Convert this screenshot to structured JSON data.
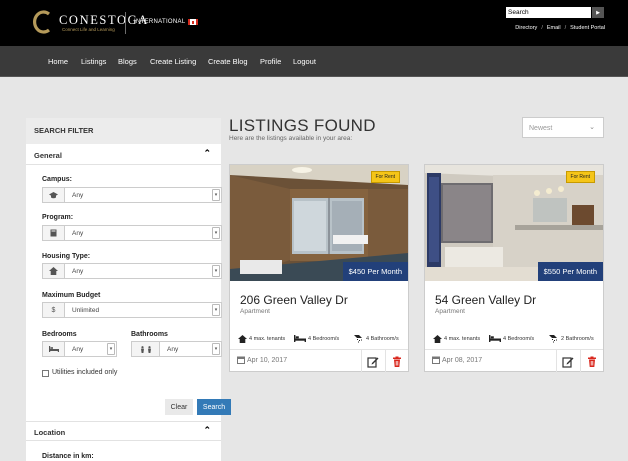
{
  "header": {
    "brand_name": "CONESTOGA",
    "brand_tagline": "Connect Life and Learning",
    "international_label": "INTERNATIONAL",
    "search_value": "Search",
    "utility_links": [
      "Directory",
      "Email",
      "Student Portal"
    ]
  },
  "nav": {
    "items": [
      "Home",
      "Listings",
      "Blogs",
      "Create Listing",
      "Create Blog",
      "Profile",
      "Logout"
    ]
  },
  "sidebar": {
    "title": "SEARCH FILTER",
    "general_section": "General",
    "campus_label": "Campus:",
    "campus_value": "Any",
    "program_label": "Program:",
    "program_value": "Any",
    "housing_label": "Housing Type:",
    "housing_value": "Any",
    "budget_label": "Maximum Budget",
    "budget_addon": "$",
    "budget_value": "Unlimited",
    "bedrooms_label": "Bedrooms",
    "bedrooms_value": "Any",
    "bathrooms_label": "Bathrooms",
    "bathrooms_value": "Any",
    "utilities_label": "Utilities included only",
    "utilities_checked": false,
    "clear_label": "Clear",
    "search_label": "Search",
    "location_section": "Location",
    "distance_label": "Distance in km:"
  },
  "main": {
    "title": "LISTINGS FOUND",
    "subtitle": "Here are the listings available in your area:",
    "sort_value": "Newest",
    "listings": [
      {
        "badge": "For Rent",
        "price": "$450 Per Month",
        "title": "206 Green Valley Dr",
        "type": "Apartment",
        "tenants": "4 max. tenants",
        "bedrooms": "4 Bedroom/s",
        "bathrooms": "4 Bathroom/s",
        "date": "Apr 10, 2017"
      },
      {
        "badge": "For Rent",
        "price": "$550 Per Month",
        "title": "54 Green Valley Dr",
        "type": "Apartment",
        "tenants": "4 max. tenants",
        "bedrooms": "4 Bedroom/s",
        "bathrooms": "2 Bathroom/s",
        "date": "Apr 08, 2017"
      }
    ]
  },
  "colors": {
    "header_bg": "#000000",
    "nav_bg": "#3a3a3a",
    "page_bg": "#e6e6e6",
    "price_bg": "#22407a",
    "badge_bg": "#f5c518",
    "search_button": "#337ab7",
    "delete_icon": "#d9261c"
  }
}
